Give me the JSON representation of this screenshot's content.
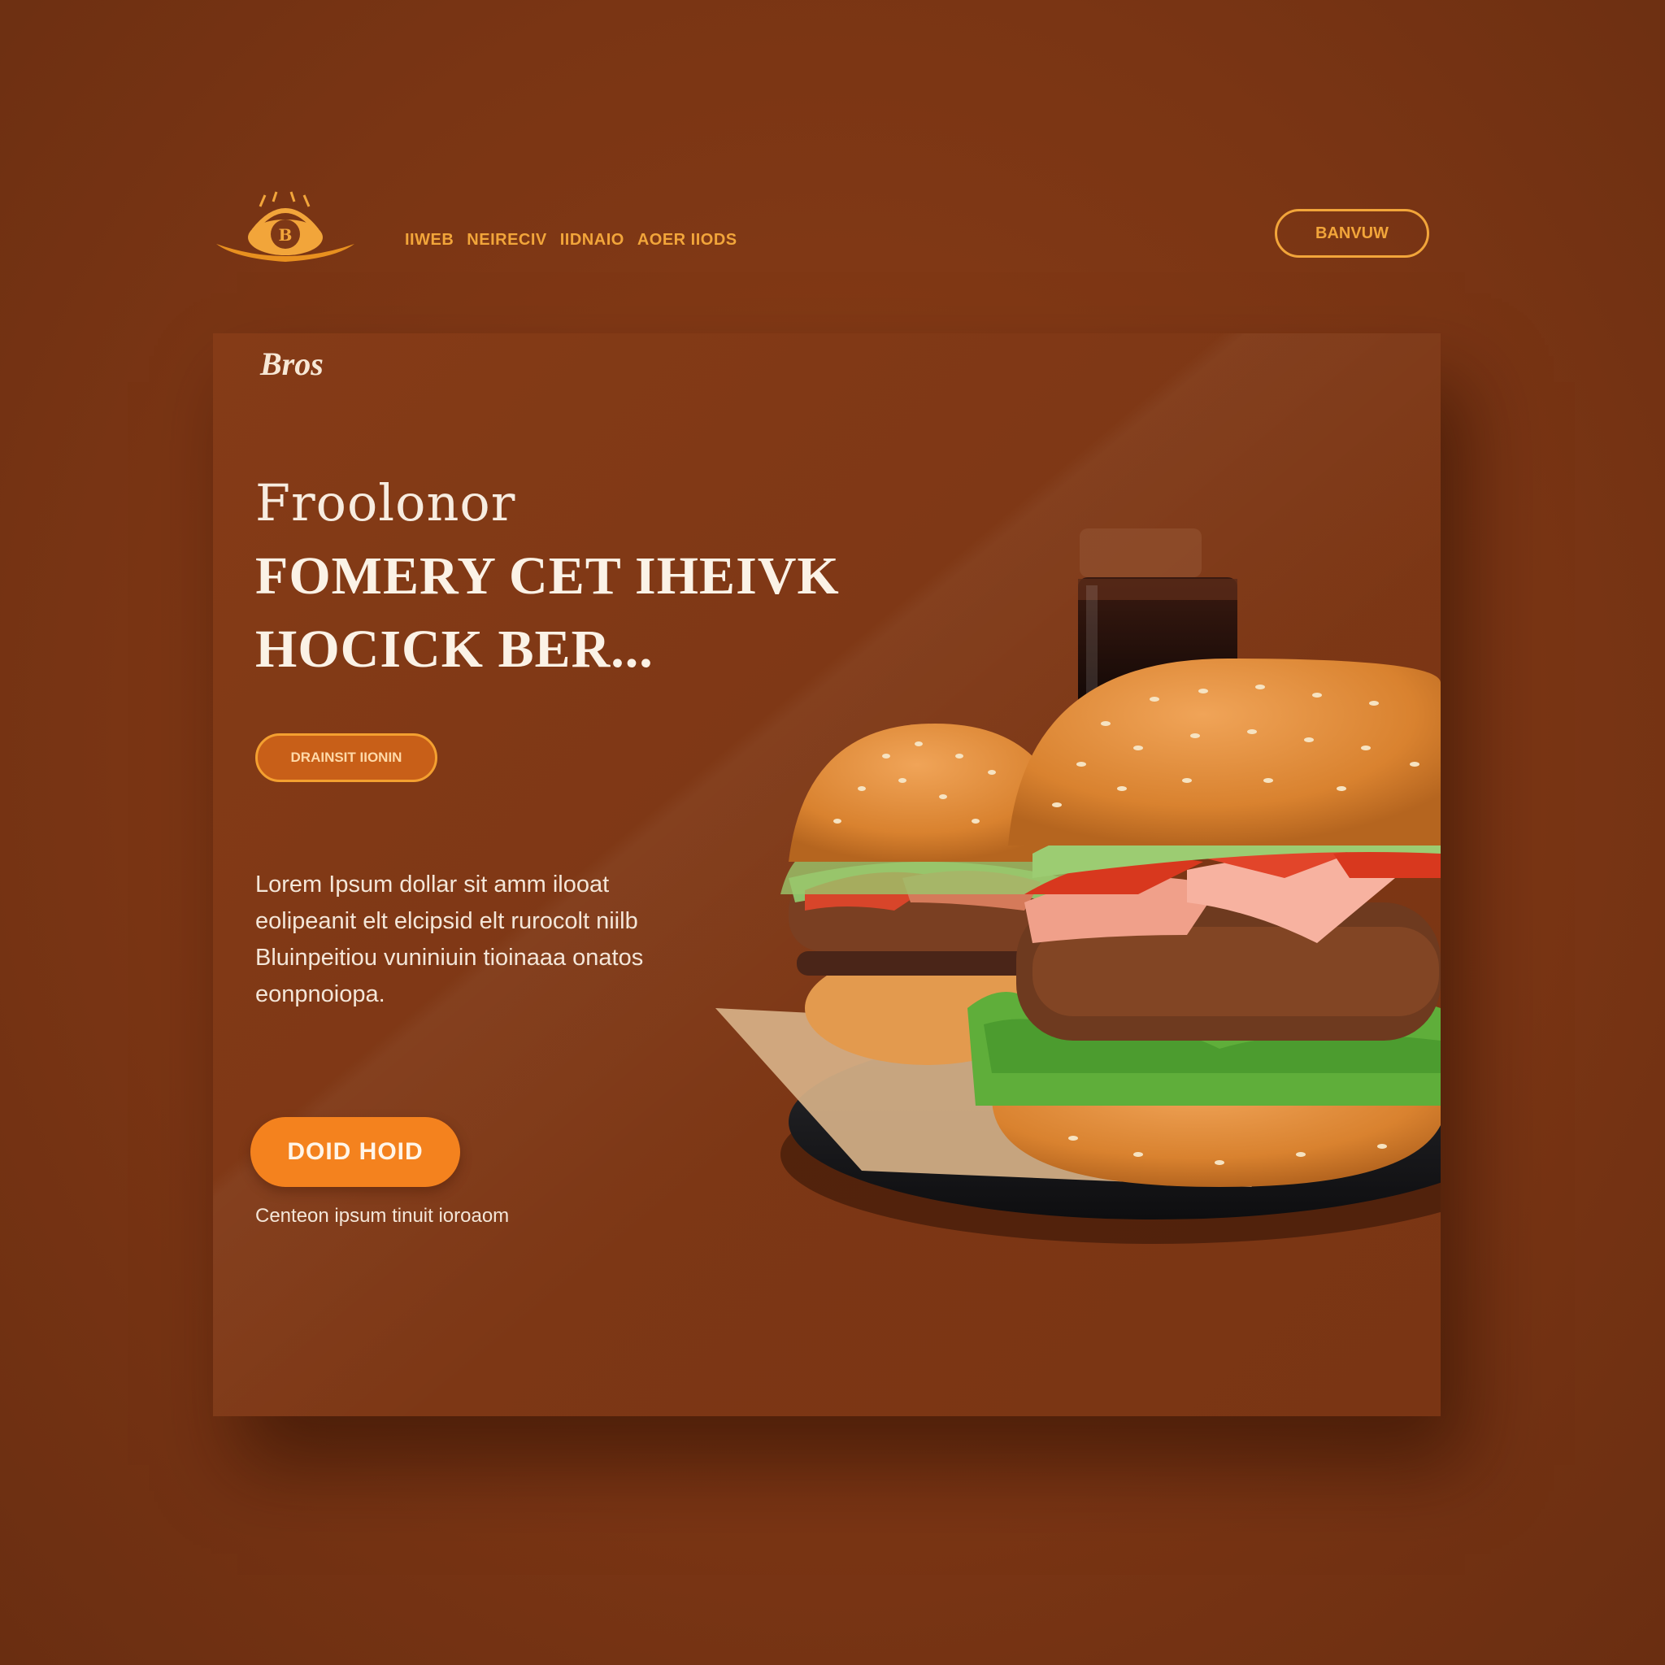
{
  "header": {
    "nav_items": [
      "IIWEB",
      "NEIRECIV",
      "IIDNAIO",
      "AOER IIODS"
    ],
    "cta_label": "BANVUW"
  },
  "hero": {
    "brand_small": "Bros",
    "eyebrow": "Froolonor",
    "title": "FOMERY CET IHEIVK\nHOCICK BER...",
    "pill_label": "DRAINSIT IIONIN",
    "body": "Lorem Ipsum dollar sit amm ilooat eolipeanit elt elcipsid elt rurocolt niilb Bluinpeitiou vuniniuin tioinaaa onatos eonpnoiopa.",
    "cta_label": "DOID HOID",
    "cta_sub": "Centeon ipsum tinuit ioroaom"
  },
  "colors": {
    "background": "#7e3816",
    "accent": "#f2a53a",
    "cta": "#f4821e",
    "text_light": "#f7ece0"
  },
  "icons": {
    "logo": "burger-emblem-icon"
  }
}
